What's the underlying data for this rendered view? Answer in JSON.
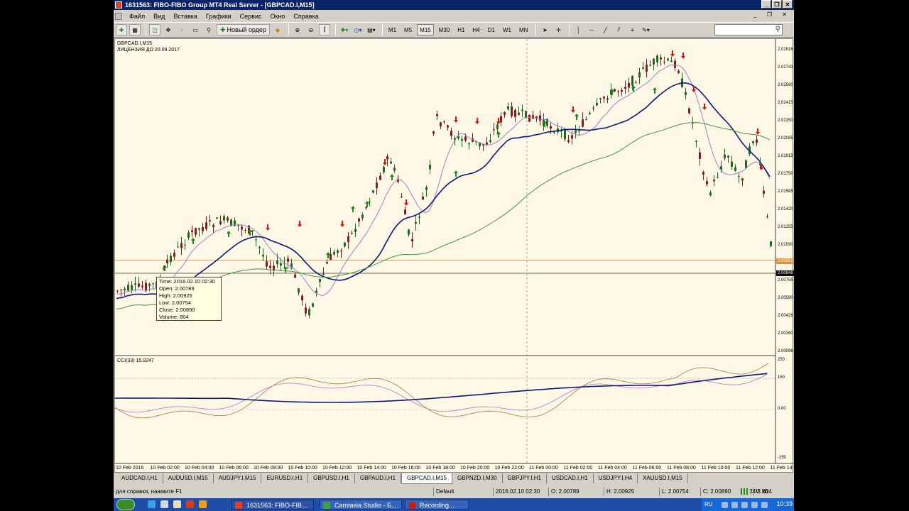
{
  "window": {
    "title": "1631563: FIBO-FIBO Group MT4 Real Server - [GBPCAD.I,M15]",
    "buttons": [
      "_",
      "❐",
      "✕"
    ]
  },
  "menu": {
    "items": [
      "Файл",
      "Вид",
      "Вставка",
      "Графики",
      "Сервис",
      "Окно",
      "Справка"
    ],
    "right_controls": "_ ❐ ✕"
  },
  "toolbar": {
    "new_order_label": "Новый ордер",
    "timeframes": [
      "M1",
      "M5",
      "M15",
      "M30",
      "H1",
      "H4",
      "D1",
      "W1",
      "MN"
    ],
    "icons": [
      "new-chart-icon",
      "profiles-icon",
      "market-watch-icon",
      "navigator-icon",
      "data-window-icon",
      "terminal-icon",
      "strategy-tester-icon",
      "new-order-icon",
      "autotrading-icon",
      "zoom-in-icon",
      "zoom-out-icon",
      "tile-icon",
      "indicators-icon",
      "periods-icon",
      "templates-icon",
      "cursor-icon",
      "crosshair-icon",
      "vertical-line-icon",
      "horizontal-line-icon",
      "trendline-icon",
      "equidistant-channel-icon",
      "fibo-icon",
      "search-icon"
    ]
  },
  "chart": {
    "symbol_header": "GBPCAD.I,M15",
    "license_text": "ЛИЦЕНЗИЯ ДО  20.09.2017",
    "cci_header": "CCI(33) 15.9247",
    "price_scale": [
      "2.02916",
      "2.02743",
      "2.02580",
      "2.02415",
      "2.02250",
      "2.02085",
      "2.01915",
      "2.01750",
      "2.01585",
      "2.01420",
      "2.01255",
      "2.01090",
      "2.00925",
      "2.00755",
      "2.00590",
      "2.00426",
      "2.00260",
      "2.00096"
    ],
    "bid_tag": "2.00953",
    "line_tag": "2.00848",
    "cci_scale": [
      "250",
      "150",
      "0.00",
      "-250"
    ],
    "time_scale": [
      "10 Feb 2016",
      "10 Feb 02:00",
      "10 Feb 04:00",
      "10 Feb 06:00",
      "10 Feb 08:00",
      "10 Feb 10:00",
      "10 Feb 12:00",
      "10 Feb 14:00",
      "10 Feb 16:00",
      "10 Feb 18:00",
      "10 Feb 20:00",
      "10 Feb 22:00",
      "11 Feb 00:00",
      "11 Feb 02:00",
      "11 Feb 04:00",
      "11 Feb 06:00",
      "11 Feb 08:00",
      "11 Feb 10:00",
      "11 Feb 12:00",
      "11 Feb 14:00"
    ],
    "tooltip": {
      "time": "Time: 2016.02.10 02:30",
      "open": "Open: 2.00789",
      "high": "High: 2.00925",
      "low": "Low:  2.00754",
      "close": "Close: 2.00890",
      "volume": "Volume: 804"
    },
    "colors": {
      "background": "#fff8e6",
      "bull": "#1e6b1e",
      "bear": "#8b1a1a",
      "ma_fast": "#9a7fc8",
      "ma_mid": "#0a1a7a",
      "ma_slow": "#3c9a3c",
      "up_arrow": "#1a8a1a",
      "down_arrow": "#e01010"
    }
  },
  "tabs": {
    "items": [
      "AUDCAD.I,H1",
      "AUDUSD.I,M15",
      "AUDJPY.I,M15",
      "EURUSD.I,H1",
      "GBPUSD.I,H1",
      "GBPAUD.I,H1",
      "GBPCAD.I,M15",
      "GBPNZD.I,M30",
      "GBPJPY.I,H1",
      "USDCAD.I,H1",
      "USDJPY.I,H4",
      "XAUUSD.I,M15"
    ],
    "active": "GBPCAD.I,M15"
  },
  "status": {
    "help": "для справки, нажмите F1",
    "profile": "Default",
    "datetime": "2016.02.10 02:30",
    "open": "O: 2.00789",
    "high": "H: 2.00925",
    "low": "L: 2.00754",
    "close": "C: 2.00890",
    "volume": "V: 804",
    "traffic": "34/3 kb"
  },
  "taskbar": {
    "tasks": [
      "1631563: FIBO-FIB...",
      "Camtasia Studio - Б...",
      "Recording..."
    ],
    "language": "RU",
    "clock": "10:39"
  }
}
